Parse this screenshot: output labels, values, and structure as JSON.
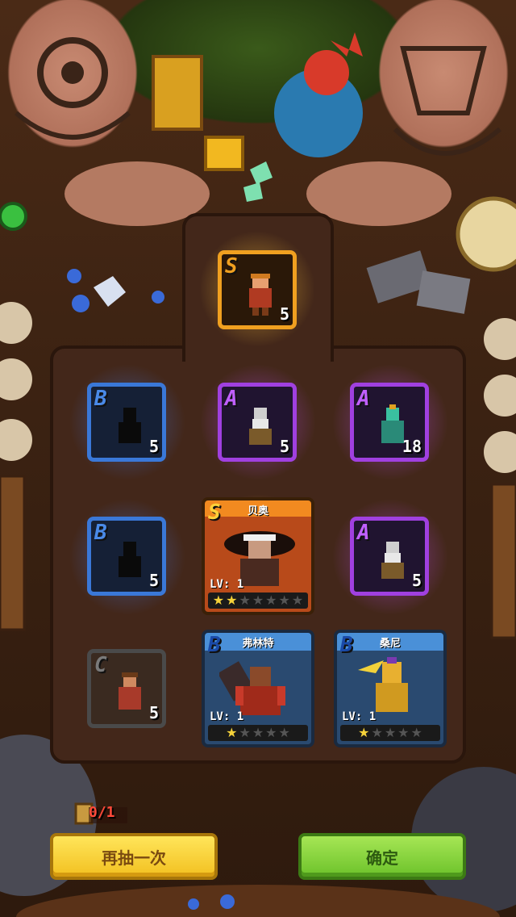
{
  "colors": {
    "grade_S": "#f0a020",
    "grade_A": "#a040e0",
    "grade_B": "#3a78d8",
    "grade_C": "#6a6a6a"
  },
  "reroll": {
    "counter": "0/1"
  },
  "buttons": {
    "reroll_label": "再抽一次",
    "confirm_label": "确定"
  },
  "slots": [
    {
      "id": "s-top",
      "type": "fragment",
      "grade": "S",
      "count": "5",
      "icon": "warrior-fragment-icon"
    },
    {
      "id": "b-1",
      "type": "fragment",
      "grade": "B",
      "count": "5",
      "icon": "unknown-hero-silhouette-icon"
    },
    {
      "id": "a-1",
      "type": "fragment",
      "grade": "A",
      "count": "5",
      "icon": "bearded-warrior-fragment-icon"
    },
    {
      "id": "a-2",
      "type": "fragment",
      "grade": "A",
      "count": "18",
      "icon": "green-monster-fragment-icon"
    },
    {
      "id": "b-2",
      "type": "fragment",
      "grade": "B",
      "count": "5",
      "icon": "unknown-hero-silhouette-icon"
    },
    {
      "id": "a-3",
      "type": "fragment",
      "grade": "A",
      "count": "5",
      "icon": "bearded-warrior-fragment-icon"
    },
    {
      "id": "c-1",
      "type": "fragment",
      "grade": "C",
      "count": "5",
      "icon": "soldier-fragment-icon"
    }
  ],
  "heroes": [
    {
      "id": "hero-beio",
      "grade": "S",
      "name": "贝奥",
      "level_label": "LV: 1",
      "stars_on": 2,
      "stars_total": 7
    },
    {
      "id": "hero-fulinte",
      "grade": "B",
      "name": "弗林特",
      "level_label": "LV: 1",
      "stars_on": 1,
      "stars_total": 5
    },
    {
      "id": "hero-sangni",
      "grade": "B",
      "name": "桑尼",
      "level_label": "LV: 1",
      "stars_on": 1,
      "stars_total": 5
    }
  ]
}
